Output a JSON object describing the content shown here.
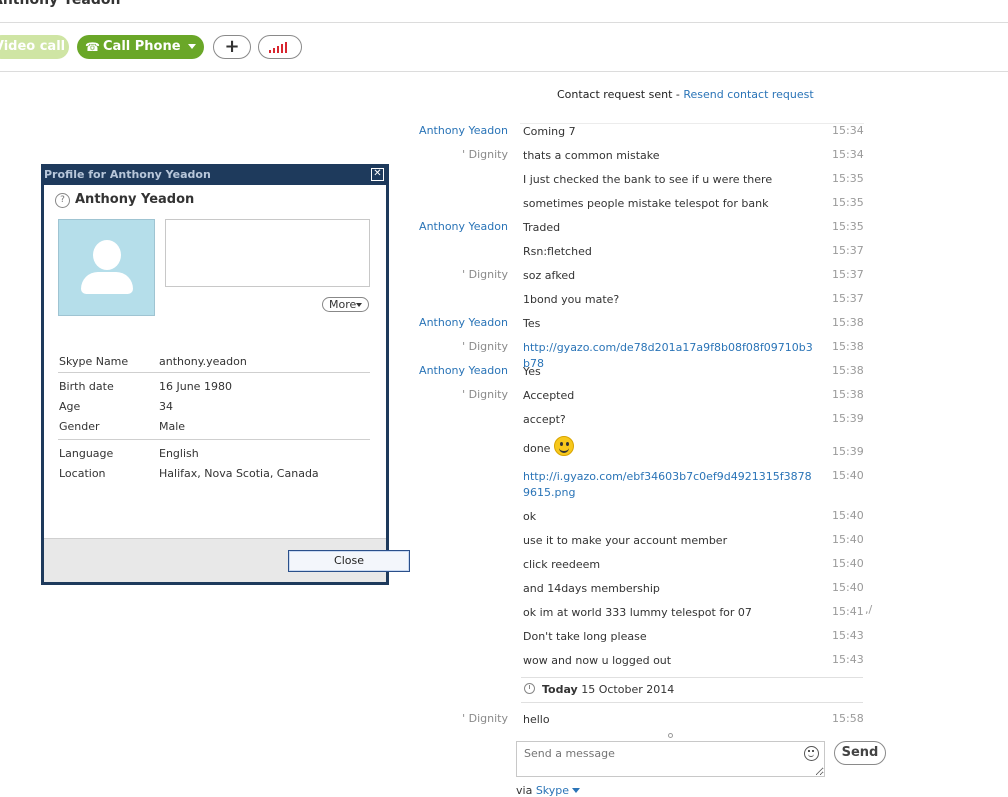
{
  "header": {
    "contact_name": "Anthony Yeadon",
    "video_call_label": "Video call",
    "call_phone_label": "Call Phone",
    "add_label": "+"
  },
  "contact_request": {
    "text": "Contact request sent -",
    "link": "Resend contact request"
  },
  "messages": [
    {
      "sender": "Anthony Yeadon",
      "text": "Coming 7",
      "time": "15:34"
    },
    {
      "sender": "' Dignity",
      "text": "thats a common mistake",
      "time": "15:34"
    },
    {
      "sender": "",
      "text": "I just checked the bank to see if u were there",
      "time": "15:35"
    },
    {
      "sender": "",
      "text": "sometimes people mistake telespot for bank",
      "time": "15:35"
    },
    {
      "sender": "Anthony Yeadon",
      "text": "Traded",
      "time": "15:35"
    },
    {
      "sender": "",
      "text": "Rsn:fletched",
      "time": "15:37"
    },
    {
      "sender": "' Dignity",
      "text": "soz afked",
      "time": "15:37"
    },
    {
      "sender": "",
      "text": "1bond you mate?",
      "time": "15:37"
    },
    {
      "sender": "Anthony Yeadon",
      "text": "Tes",
      "time": "15:38"
    },
    {
      "sender": "' Dignity",
      "text": "http://gyazo.com/de78d201a17a9f8b08f08f09710b3b78",
      "time": "15:38"
    },
    {
      "sender": "Anthony Yeadon",
      "text": "Yes",
      "time": "15:38"
    },
    {
      "sender": "' Dignity",
      "text": "Accepted",
      "time": "15:38"
    },
    {
      "sender": "",
      "text": "accept?",
      "time": "15:39"
    },
    {
      "sender": "",
      "text": "done",
      "time": "15:39"
    },
    {
      "sender": "",
      "text": "http://i.gyazo.com/ebf34603b7c0ef9d4921315f38789615.png",
      "time": "15:40"
    },
    {
      "sender": "",
      "text": "ok",
      "time": "15:40"
    },
    {
      "sender": "",
      "text": "use it to make your account member",
      "time": "15:40"
    },
    {
      "sender": "",
      "text": "click reedeem",
      "time": "15:40"
    },
    {
      "sender": "",
      "text": "and 14days membership",
      "time": "15:40"
    },
    {
      "sender": "",
      "text": "ok im at world 333 lummy telespot for 07",
      "time": "15:41"
    },
    {
      "sender": "",
      "text": "Don't take long please",
      "time": "15:43"
    },
    {
      "sender": "",
      "text": "wow and now u logged out",
      "time": "15:43"
    }
  ],
  "today_divider": {
    "label": "Today",
    "date": "15 October 2014"
  },
  "today_message": {
    "sender": "' Dignity",
    "text": "hello",
    "time": "15:58"
  },
  "composer": {
    "placeholder": "Send a message",
    "send_label": "Send",
    "via_prefix": "via",
    "via_link": "Skype"
  },
  "profile": {
    "window_title": "Profile for Anthony Yeadon",
    "name": "Anthony Yeadon",
    "more_label": "More",
    "skype_name_label": "Skype Name",
    "skype_name": "anthony.yeadon",
    "birth_date_label": "Birth date",
    "birth_date": "16 June 1980",
    "age_label": "Age",
    "age": "34",
    "gender_label": "Gender",
    "gender": "Male",
    "language_label": "Language",
    "language": "English",
    "location_label": "Location",
    "location": "Halifax, Nova Scotia, Canada",
    "close_label": "Close"
  },
  "colors": {
    "accent": "#2a74b7",
    "call_green": "#6aa728",
    "dialog_frame": "#1e3a5c"
  }
}
